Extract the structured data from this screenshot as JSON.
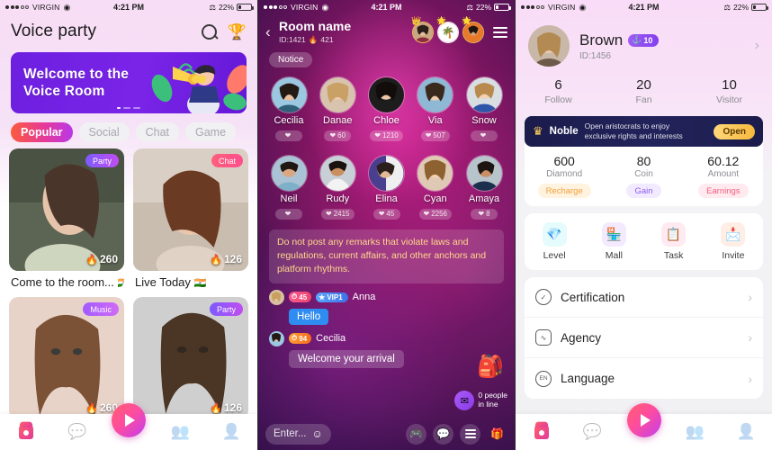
{
  "status_bar": {
    "carrier": "VIRGIN",
    "time": "4:21 PM",
    "battery": "22%",
    "wifi_icon": "wifi-icon",
    "bluetooth_icon": "bluetooth-icon"
  },
  "panel1": {
    "title": "Voice party",
    "search_icon": "search-icon",
    "trophy_icon": "trophy-icon",
    "banner": {
      "line1": "Welcome to the",
      "line2": "Voice Room",
      "dots": 3
    },
    "tabs": [
      {
        "label": "Popular",
        "active": true
      },
      {
        "label": "Social",
        "active": false
      },
      {
        "label": "Chat",
        "active": false
      },
      {
        "label": "Game",
        "active": false
      }
    ],
    "menu_icon": "hamburger-icon",
    "cards": [
      {
        "tag": "Party",
        "tag_type": "party",
        "hot": "260",
        "title": "Come to the room...",
        "flag": "🇮🇳"
      },
      {
        "tag": "Chat",
        "tag_type": "chat",
        "hot": "126",
        "title": "Live Today",
        "flag": "🇮🇳"
      },
      {
        "tag": "Music",
        "tag_type": "music",
        "hot": "260",
        "title": "",
        "flag": ""
      },
      {
        "tag": "Party",
        "tag_type": "party",
        "hot": "126",
        "title": "",
        "flag": ""
      }
    ],
    "tabbar": [
      {
        "icon": "home-icon",
        "active": true
      },
      {
        "icon": "message-icon",
        "active": false
      },
      {
        "icon": "play-icon",
        "active": false
      },
      {
        "icon": "group-icon",
        "active": false
      },
      {
        "icon": "profile-icon",
        "active": false
      }
    ]
  },
  "panel2": {
    "back_icon": "chevron-left-icon",
    "room_name": "Room name",
    "room_id": "ID:1421",
    "room_hot": "421",
    "hot_icon": "flame-icon",
    "menu_icon": "hamburger-icon",
    "notice": "Notice",
    "header_avatars": [
      {
        "name": "host-avatar-1",
        "crown": "👑"
      },
      {
        "name": "host-avatar-2",
        "crown": "🌟"
      },
      {
        "name": "host-avatar-3",
        "crown": "🌟"
      }
    ],
    "seats_row1": [
      {
        "name": "Cecilia",
        "likes": ""
      },
      {
        "name": "Danae",
        "likes": "60"
      },
      {
        "name": "Chloe",
        "likes": "1210"
      },
      {
        "name": "Via",
        "likes": "507"
      },
      {
        "name": "Snow",
        "likes": ""
      }
    ],
    "seats_row2": [
      {
        "name": "Neil",
        "likes": ""
      },
      {
        "name": "Rudy",
        "likes": "2415"
      },
      {
        "name": "Elina",
        "likes": "45"
      },
      {
        "name": "Cyan",
        "likes": "2256"
      },
      {
        "name": "Amaya",
        "likes": "8"
      }
    ],
    "rules_text": "Do not post any remarks that violate laws and regulations, current affairs, and other anchors and platform rhythms.",
    "messages": [
      {
        "user": "Anna",
        "level": "45",
        "vip": "VIP1",
        "text": "Hello",
        "bubble": "blue"
      },
      {
        "user": "Cecilia",
        "level": "94",
        "vip": "",
        "text": "Welcome your arrival",
        "bubble": "grey"
      }
    ],
    "chest_icon": "treasure-chest-icon",
    "queue": {
      "line1": "0 people",
      "line2": "in line",
      "icon": "envelope-icon"
    },
    "input_placeholder": "Enter...",
    "emoji_icon": "smiley-icon",
    "bottom_icons": [
      {
        "name": "game-controller-icon",
        "glyph": "🎮"
      },
      {
        "name": "chat-bubble-icon",
        "glyph": "💬"
      },
      {
        "name": "hamburger-icon",
        "glyph": ""
      },
      {
        "name": "gift-icon",
        "glyph": "🎁"
      }
    ]
  },
  "panel3": {
    "name": "Brown",
    "level_badge": "10",
    "level_icon": "level-icon",
    "id": "ID:1456",
    "chevron_icon": "chevron-right-icon",
    "stats": [
      {
        "num": "6",
        "label": "Follow"
      },
      {
        "num": "20",
        "label": "Fan"
      },
      {
        "num": "10",
        "label": "Visitor"
      }
    ],
    "noble": {
      "crown_icon": "crown-icon",
      "label": "Noble",
      "desc_line1": "Open aristocrats to enjoy",
      "desc_line2": "exclusive rights and interests",
      "button": "Open"
    },
    "wallet": [
      {
        "num": "600",
        "label": "Diamond",
        "pill": "Recharge"
      },
      {
        "num": "80",
        "label": "Coin",
        "pill": "Gain"
      },
      {
        "num": "60.12",
        "label": "Amount",
        "pill": "Earnings"
      }
    ],
    "quick": [
      {
        "label": "Level",
        "icon": "level-badge-icon",
        "glyph": "💎",
        "color": "#2fd6d6"
      },
      {
        "label": "Mall",
        "icon": "mall-icon",
        "glyph": "🏪",
        "color": "#9b59f0"
      },
      {
        "label": "Task",
        "icon": "task-clipboard-icon",
        "glyph": "📋",
        "color": "#f0457f"
      },
      {
        "label": "Invite",
        "icon": "invite-mail-icon",
        "glyph": "📩",
        "color": "#f4703a"
      }
    ],
    "menu": [
      {
        "label": "Certification",
        "icon": "certification-icon",
        "glyph": "✓"
      },
      {
        "label": "Agency",
        "icon": "agency-icon",
        "glyph": "∿"
      },
      {
        "label": "Language",
        "icon": "language-icon",
        "glyph": "EN"
      }
    ],
    "tabbar": [
      {
        "icon": "home-icon",
        "active": true
      },
      {
        "icon": "message-icon",
        "active": false
      },
      {
        "icon": "play-icon",
        "active": false
      },
      {
        "icon": "group-icon",
        "active": false
      },
      {
        "icon": "profile-icon",
        "active": false
      }
    ]
  },
  "colors": {
    "accent_pink": "#e5399a",
    "accent_purple": "#8340ec",
    "banner_purple": "#6d1fe0",
    "heart_red": "#ff3f6e",
    "noble_navy": "#1b1c4b",
    "noble_gold": "#f6b93b"
  }
}
